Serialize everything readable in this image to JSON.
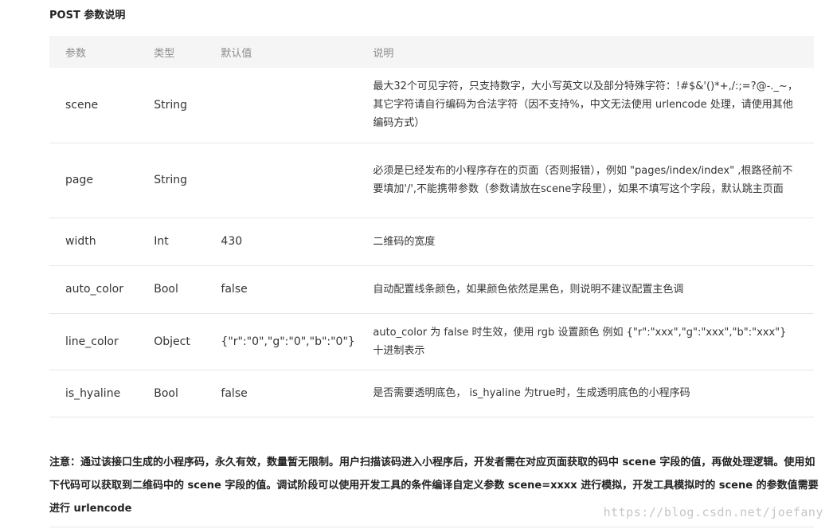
{
  "section_title": "POST 参数说明",
  "table": {
    "headers": [
      "参数",
      "类型",
      "默认值",
      "说明"
    ],
    "rows": [
      {
        "param": "scene",
        "type": "String",
        "default": "",
        "desc": "最大32个可见字符，只支持数字，大小写英文以及部分特殊字符：!#$&'()*+,/:;=?@-._~，其它字符请自行编码为合法字符（因不支持%，中文无法使用 urlencode 处理，请使用其他编码方式）"
      },
      {
        "param": "page",
        "type": "String",
        "default": "",
        "desc": "必须是已经发布的小程序存在的页面（否则报错），例如 \"pages/index/index\" ,根路径前不要填加'/',不能携带参数（参数请放在scene字段里），如果不填写这个字段，默认跳主页面"
      },
      {
        "param": "width",
        "type": "Int",
        "default": "430",
        "desc": "二维码的宽度"
      },
      {
        "param": "auto_color",
        "type": "Bool",
        "default": "false",
        "desc": "自动配置线条颜色，如果颜色依然是黑色，则说明不建议配置主色调"
      },
      {
        "param": "line_color",
        "type": "Object",
        "default": "{\"r\":\"0\",\"g\":\"0\",\"b\":\"0\"}",
        "desc": "auto_color 为 false 时生效，使用 rgb 设置颜色 例如 {\"r\":\"xxx\",\"g\":\"xxx\",\"b\":\"xxx\"} 十进制表示"
      },
      {
        "param": "is_hyaline",
        "type": "Bool",
        "default": "false",
        "desc": "是否需要透明底色， is_hyaline 为true时，生成透明底色的小程序码"
      }
    ]
  },
  "note": "注意：通过该接口生成的小程序码，永久有效，数量暂无限制。用户扫描该码进入小程序后，开发者需在对应页面获取的码中 scene 字段的值，再做处理逻辑。使用如下代码可以获取到二维码中的 scene 字段的值。调试阶段可以使用开发工具的条件编译自定义参数 scene=xxxx 进行模拟，开发工具模拟时的 scene 的参数值需要进行 urlencode",
  "watermark": "https://blog.csdn.net/joefany"
}
